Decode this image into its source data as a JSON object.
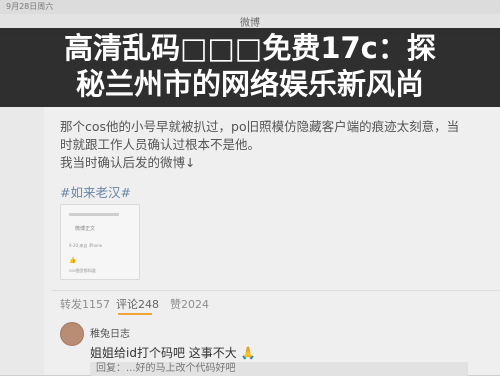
{
  "status_bar": {
    "date": "9月28日周六"
  },
  "title_bar": {
    "title": "微博"
  },
  "banner": {
    "line1": "高清乱码□□□免费17c：探",
    "line2": "秘兰州市的网络娱乐新风尚"
  },
  "post": {
    "paragraph": "那个cos他的小号早就被扒过，po旧照模仿隐藏客户端的痕迹太刻意，当时就跟工作人员确认过根本不是他。",
    "paragraph2": "我当时确认后发的微博↓",
    "hashtag": "#如来老汉#"
  },
  "embed_card": {
    "name": "微博正文",
    "meta": "9-20 来自 iPhone",
    "like": "👍",
    "footer": "cos圈里都知道"
  },
  "tabs": {
    "repost": "转发1157",
    "comments": "评论248",
    "likes": "赞2024"
  },
  "comment": {
    "user": "稚兔日志",
    "text": "姐姐给id打个码吧 这事不大 🙏",
    "reply_preview": "回复：...好的马上改个代码好吧"
  },
  "colors": {
    "accent": "#f0a637",
    "hashtag": "#6a86a6",
    "banner_bg": "#141414"
  }
}
